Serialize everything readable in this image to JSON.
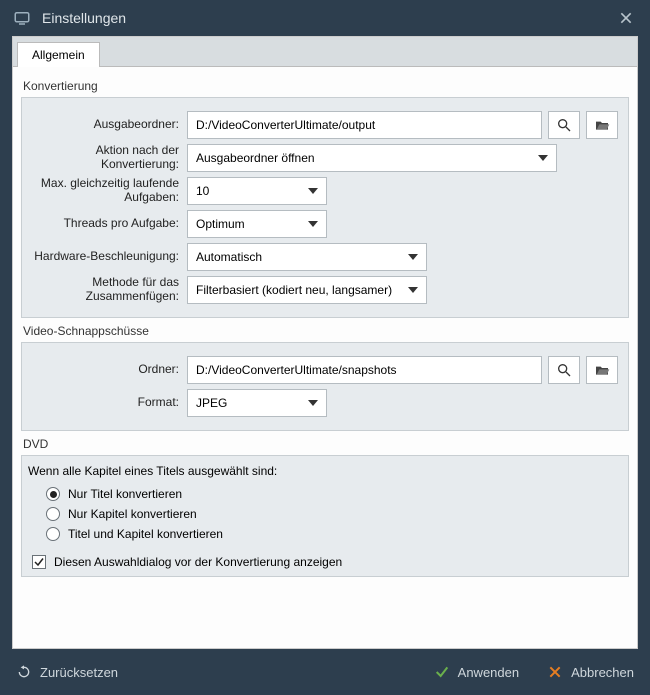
{
  "window": {
    "title": "Einstellungen"
  },
  "tabs": {
    "general": "Allgemein"
  },
  "sections": {
    "conversion": {
      "title": "Konvertierung",
      "output_folder_label": "Ausgabeordner:",
      "output_folder_value": "D:/VideoConverterUltimate/output",
      "post_action_label": "Aktion nach der Konvertierung:",
      "post_action_value": "Ausgabeordner öffnen",
      "max_tasks_label": "Max. gleichzeitig laufende Aufgaben:",
      "max_tasks_value": "10",
      "threads_label": "Threads pro Aufgabe:",
      "threads_value": "Optimum",
      "hwaccel_label": "Hardware-Beschleunigung:",
      "hwaccel_value": "Automatisch",
      "merge_label": "Methode für das Zusammenfügen:",
      "merge_value": "Filterbasiert (kodiert neu, langsamer)"
    },
    "snapshots": {
      "title": "Video-Schnappschüsse",
      "folder_label": "Ordner:",
      "folder_value": "D:/VideoConverterUltimate/snapshots",
      "format_label": "Format:",
      "format_value": "JPEG"
    },
    "dvd": {
      "title": "DVD",
      "intro": "Wenn alle Kapitel eines Titels ausgewählt sind:",
      "opt_title_only": "Nur Titel konvertieren",
      "opt_chapters_only": "Nur Kapitel konvertieren",
      "opt_both": "Titel und Kapitel konvertieren",
      "selected": "title_only",
      "show_dialog_label": "Diesen Auswahldialog vor der Konvertierung anzeigen",
      "show_dialog_checked": true
    }
  },
  "footer": {
    "reset": "Zurücksetzen",
    "apply": "Anwenden",
    "cancel": "Abbrechen"
  },
  "colors": {
    "accent_green": "#6ab04c",
    "accent_orange": "#e67e22"
  }
}
